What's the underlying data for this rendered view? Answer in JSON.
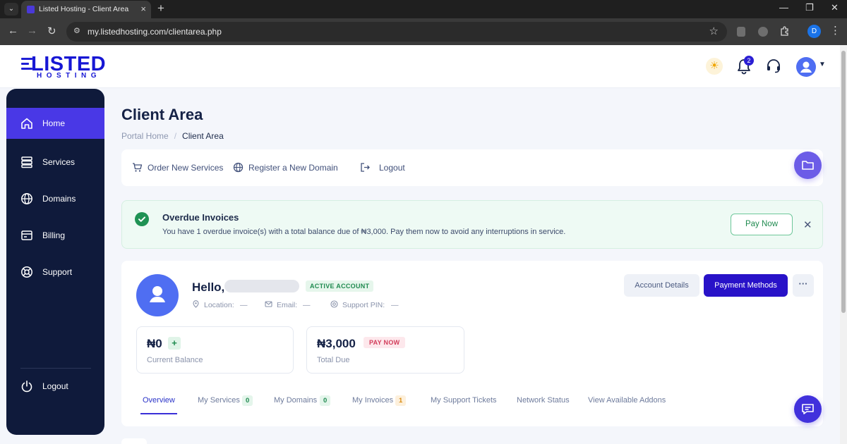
{
  "browser": {
    "tab_title": "Listed Hosting - Client Area",
    "url": "my.listedhosting.com/clientarea.php",
    "profile_initial": "D"
  },
  "brand": {
    "logo_main": "LISTED",
    "logo_sub": "HOSTING",
    "accent": "#1717d4"
  },
  "header": {
    "notification_count": "2"
  },
  "sidebar": {
    "items": [
      {
        "label": "Home",
        "icon": "home-icon",
        "active": true
      },
      {
        "label": "Services",
        "icon": "server-icon"
      },
      {
        "label": "Domains",
        "icon": "globe-icon"
      },
      {
        "label": "Billing",
        "icon": "billing-icon"
      },
      {
        "label": "Support",
        "icon": "lifebuoy-icon"
      }
    ],
    "logout_label": "Logout"
  },
  "page": {
    "title": "Client Area",
    "breadcrumb": [
      "Portal Home",
      "Client Area"
    ]
  },
  "actions": {
    "order": "Order New Services",
    "register": "Register a New Domain",
    "logout": "Logout"
  },
  "alert": {
    "title": "Overdue Invoices",
    "text": "You have 1 overdue invoice(s) with a total balance due of ₦3,000. Pay them now to avoid any interruptions in service.",
    "button": "Pay Now"
  },
  "account": {
    "greeting": "Hello,",
    "status": "ACTIVE ACCOUNT",
    "location_label": "Location:",
    "location_value": "—",
    "email_label": "Email:",
    "email_value": "—",
    "pin_label": "Support PIN:",
    "pin_value": "—",
    "details_button": "Account Details",
    "payment_button": "Payment Methods",
    "more_button": "···"
  },
  "stats": {
    "balance_value": "₦0",
    "balance_label": "Current Balance",
    "balance_badge": "+",
    "due_value": "₦3,000",
    "due_label": "Total Due",
    "due_badge": "PAY NOW"
  },
  "tabs": [
    {
      "label": "Overview"
    },
    {
      "label": "My Services",
      "count": "0"
    },
    {
      "label": "My Domains",
      "count": "0"
    },
    {
      "label": "My Invoices",
      "count": "1"
    },
    {
      "label": "My Support Tickets"
    },
    {
      "label": "Network Status"
    },
    {
      "label": "View Available Addons"
    }
  ]
}
